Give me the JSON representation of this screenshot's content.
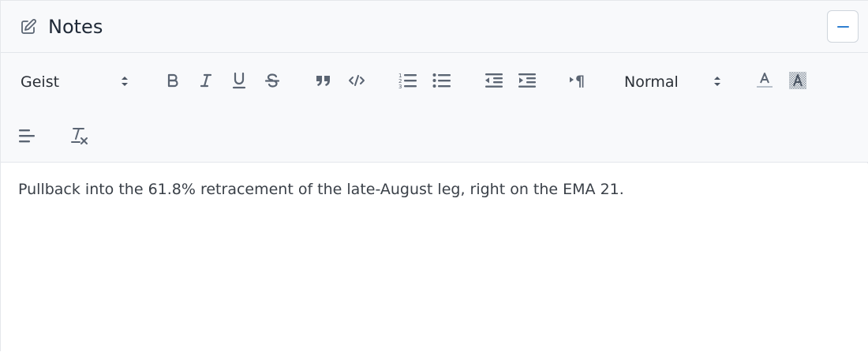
{
  "panel": {
    "title": "Notes",
    "title_icon": "pencil-square-icon",
    "collapse_icon": "minus-icon"
  },
  "toolbar": {
    "font_family": "Geist",
    "heading_format": "Normal",
    "buttons": [
      "bold-icon",
      "italic-icon",
      "underline-icon",
      "strikethrough-icon",
      "blockquote-icon",
      "code-block-icon",
      "ordered-list-icon",
      "bullet-list-icon",
      "outdent-icon",
      "indent-icon",
      "text-direction-icon",
      "text-color-icon",
      "background-color-icon",
      "align-left-icon",
      "clear-formatting-icon"
    ]
  },
  "editor": {
    "content": "Pullback into the 61.8% retracement of the late-August leg, right on the EMA 21."
  },
  "colors": {
    "accent": "#2f7fd1",
    "icon": "#5b6573",
    "toolbar_bg": "#f8f9fb",
    "border": "#e3e6eb"
  }
}
